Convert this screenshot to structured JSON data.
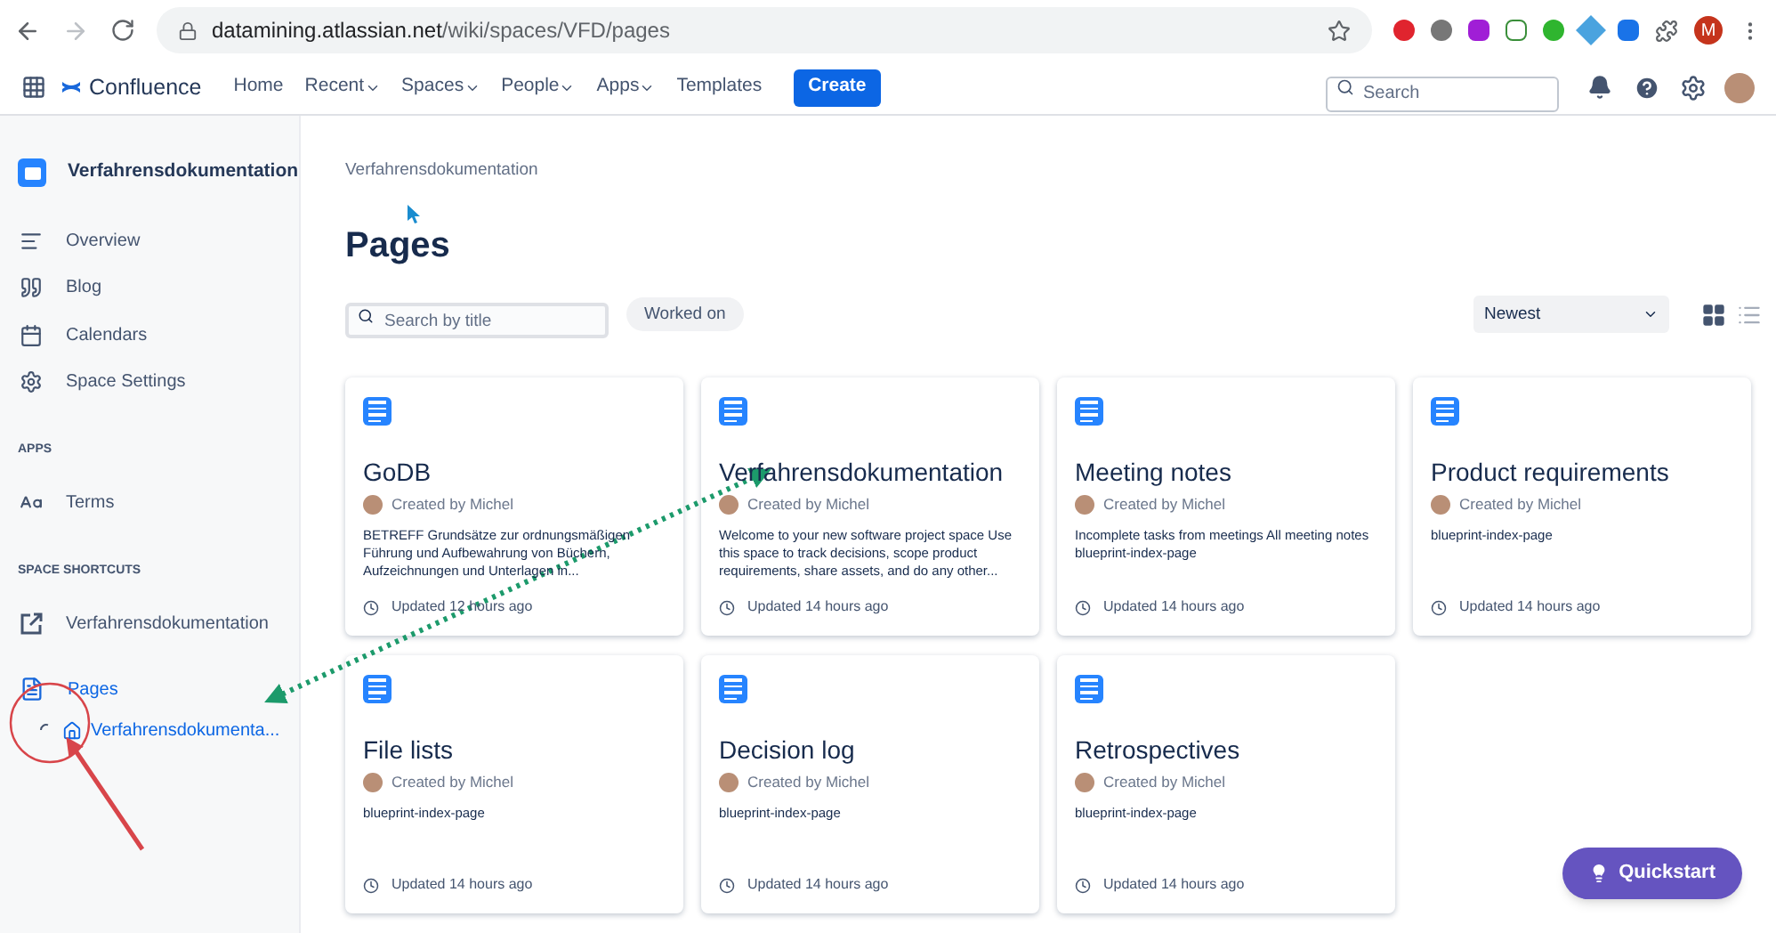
{
  "browser": {
    "url_host": "datamining.atlassian.net",
    "url_path": "/wiki/spaces/VFD/pages",
    "profile_initial": "M"
  },
  "nav": {
    "product": "Confluence",
    "items": [
      {
        "label": "Home",
        "dropdown": false
      },
      {
        "label": "Recent",
        "dropdown": true
      },
      {
        "label": "Spaces",
        "dropdown": true
      },
      {
        "label": "People",
        "dropdown": true
      },
      {
        "label": "Apps",
        "dropdown": true
      },
      {
        "label": "Templates",
        "dropdown": false
      }
    ],
    "create": "Create",
    "search": {
      "placeholder": "Search"
    }
  },
  "sidebar": {
    "space_name": "Verfahrensdokumentation",
    "items": [
      {
        "kind": "overview",
        "label": "Overview"
      },
      {
        "kind": "blog",
        "label": "Blog"
      },
      {
        "kind": "calendar",
        "label": "Calendars"
      },
      {
        "kind": "settings",
        "label": "Space Settings"
      }
    ],
    "apps_heading": "APPS",
    "apps": [
      {
        "kind": "terms",
        "label": "Terms"
      }
    ],
    "shortcuts_heading": "SPACE SHORTCUTS",
    "shortcuts": [
      {
        "kind": "link",
        "label": "Verfahrensdokumentation"
      }
    ],
    "pages": {
      "label": "Pages",
      "selected": true,
      "children": [
        {
          "label": "Verfahrensdokumenta...",
          "loading": true
        }
      ]
    }
  },
  "main": {
    "breadcrumb": "Verfahrensdokumentation",
    "title": "Pages",
    "search": {
      "placeholder": "Search by title"
    },
    "filter": "Worked on",
    "sort": "Newest",
    "views": [
      {
        "kind": "grid",
        "selected": true
      },
      {
        "kind": "list",
        "selected": false
      }
    ],
    "cards": [
      {
        "title": "GoDB",
        "author": "Created by Michel",
        "excerpt": "BETREFF Grundsätze zur ordnungsmäßigen Führung und Aufbewahrung von Büchern, Aufzeichnungen und Unterlagen in...",
        "updated": "Updated 12 hours ago"
      },
      {
        "title": "Verfahrensdokumentation",
        "author": "Created by Michel",
        "excerpt": "Welcome to your new software project space Use this space to track decisions, scope product requirements, share assets, and do any other...",
        "updated": "Updated 14 hours ago"
      },
      {
        "title": "Meeting notes",
        "author": "Created by Michel",
        "excerpt": "Incomplete tasks from meetings All meeting notes blueprint-index-page",
        "updated": "Updated 14 hours ago"
      },
      {
        "title": "Product requirements",
        "author": "Created by Michel",
        "excerpt": "blueprint-index-page",
        "updated": "Updated 14 hours ago"
      },
      {
        "title": "File lists",
        "author": "Created by Michel",
        "excerpt": "blueprint-index-page",
        "updated": "Updated 14 hours ago"
      },
      {
        "title": "Decision log",
        "author": "Created by Michel",
        "excerpt": "blueprint-index-page",
        "updated": "Updated 14 hours ago"
      },
      {
        "title": "Retrospectives",
        "author": "Created by Michel",
        "excerpt": "blueprint-index-page",
        "updated": "Updated 14 hours ago"
      }
    ]
  },
  "quickstart": "Quickstart"
}
